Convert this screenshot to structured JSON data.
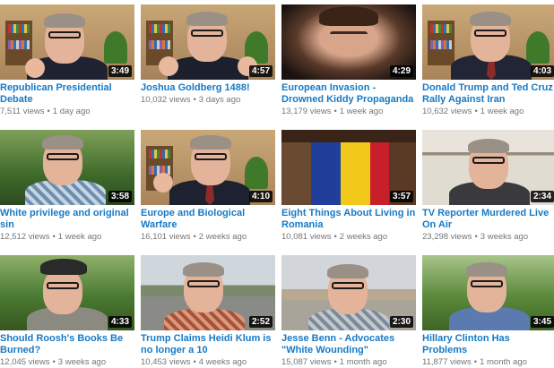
{
  "videos": [
    {
      "title": "Republican Presidential Debate",
      "duration": "3:49",
      "views": "7,511 views",
      "age": "1 day ago"
    },
    {
      "title": "Joshua Goldberg 1488!",
      "duration": "4:57",
      "views": "10,032 views",
      "age": "3 days ago"
    },
    {
      "title": "European Invasion - Drowned Kiddy Propaganda",
      "duration": "4:29",
      "views": "13,179 views",
      "age": "1 week ago"
    },
    {
      "title": "Donald Trump and Ted Cruz Rally Against Iran",
      "duration": "4:03",
      "views": "10,632 views",
      "age": "1 week ago"
    },
    {
      "title": "White privilege and original sin",
      "duration": "3:58",
      "views": "12,512 views",
      "age": "1 week ago"
    },
    {
      "title": "Europe and Biological Warfare",
      "duration": "4:10",
      "views": "16,101 views",
      "age": "2 weeks ago"
    },
    {
      "title": "Eight Things About Living in Romania",
      "duration": "3:57",
      "views": "10,081 views",
      "age": "2 weeks ago"
    },
    {
      "title": "TV Reporter Murdered Live On Air",
      "duration": "2:34",
      "views": "23,298 views",
      "age": "3 weeks ago"
    },
    {
      "title": "Should Roosh's Books Be Burned?",
      "duration": "4:33",
      "views": "12,045 views",
      "age": "3 weeks ago"
    },
    {
      "title": "Trump Claims Heidi Klum is no longer a 10",
      "duration": "2:52",
      "views": "10,453 views",
      "age": "4 weeks ago"
    },
    {
      "title": "Jesse Benn - Advocates \"White Wounding\"",
      "duration": "2:30",
      "views": "15,087 views",
      "age": "1 month ago"
    },
    {
      "title": "Hillary Clinton Has Problems",
      "duration": "3:45",
      "views": "11,877 views",
      "age": "1 month ago"
    }
  ],
  "meta_separator": "•"
}
